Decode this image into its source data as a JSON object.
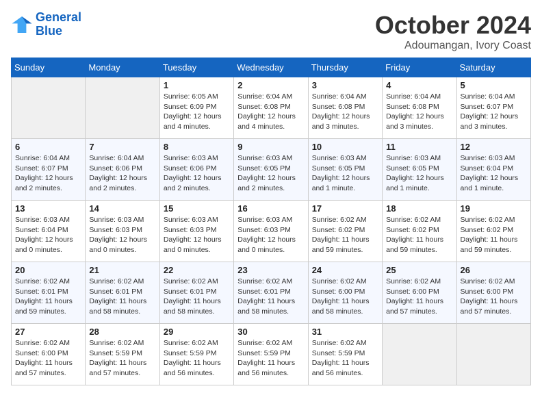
{
  "logo": {
    "line1": "General",
    "line2": "Blue"
  },
  "title": "October 2024",
  "subtitle": "Adoumangan, Ivory Coast",
  "weekdays": [
    "Sunday",
    "Monday",
    "Tuesday",
    "Wednesday",
    "Thursday",
    "Friday",
    "Saturday"
  ],
  "weeks": [
    [
      {
        "day": "",
        "info": ""
      },
      {
        "day": "",
        "info": ""
      },
      {
        "day": "1",
        "info": "Sunrise: 6:05 AM\nSunset: 6:09 PM\nDaylight: 12 hours\nand 4 minutes."
      },
      {
        "day": "2",
        "info": "Sunrise: 6:04 AM\nSunset: 6:08 PM\nDaylight: 12 hours\nand 4 minutes."
      },
      {
        "day": "3",
        "info": "Sunrise: 6:04 AM\nSunset: 6:08 PM\nDaylight: 12 hours\nand 3 minutes."
      },
      {
        "day": "4",
        "info": "Sunrise: 6:04 AM\nSunset: 6:08 PM\nDaylight: 12 hours\nand 3 minutes."
      },
      {
        "day": "5",
        "info": "Sunrise: 6:04 AM\nSunset: 6:07 PM\nDaylight: 12 hours\nand 3 minutes."
      }
    ],
    [
      {
        "day": "6",
        "info": "Sunrise: 6:04 AM\nSunset: 6:07 PM\nDaylight: 12 hours\nand 2 minutes."
      },
      {
        "day": "7",
        "info": "Sunrise: 6:04 AM\nSunset: 6:06 PM\nDaylight: 12 hours\nand 2 minutes."
      },
      {
        "day": "8",
        "info": "Sunrise: 6:03 AM\nSunset: 6:06 PM\nDaylight: 12 hours\nand 2 minutes."
      },
      {
        "day": "9",
        "info": "Sunrise: 6:03 AM\nSunset: 6:05 PM\nDaylight: 12 hours\nand 2 minutes."
      },
      {
        "day": "10",
        "info": "Sunrise: 6:03 AM\nSunset: 6:05 PM\nDaylight: 12 hours\nand 1 minute."
      },
      {
        "day": "11",
        "info": "Sunrise: 6:03 AM\nSunset: 6:05 PM\nDaylight: 12 hours\nand 1 minute."
      },
      {
        "day": "12",
        "info": "Sunrise: 6:03 AM\nSunset: 6:04 PM\nDaylight: 12 hours\nand 1 minute."
      }
    ],
    [
      {
        "day": "13",
        "info": "Sunrise: 6:03 AM\nSunset: 6:04 PM\nDaylight: 12 hours\nand 0 minutes."
      },
      {
        "day": "14",
        "info": "Sunrise: 6:03 AM\nSunset: 6:03 PM\nDaylight: 12 hours\nand 0 minutes."
      },
      {
        "day": "15",
        "info": "Sunrise: 6:03 AM\nSunset: 6:03 PM\nDaylight: 12 hours\nand 0 minutes."
      },
      {
        "day": "16",
        "info": "Sunrise: 6:03 AM\nSunset: 6:03 PM\nDaylight: 12 hours\nand 0 minutes."
      },
      {
        "day": "17",
        "info": "Sunrise: 6:02 AM\nSunset: 6:02 PM\nDaylight: 11 hours\nand 59 minutes."
      },
      {
        "day": "18",
        "info": "Sunrise: 6:02 AM\nSunset: 6:02 PM\nDaylight: 11 hours\nand 59 minutes."
      },
      {
        "day": "19",
        "info": "Sunrise: 6:02 AM\nSunset: 6:02 PM\nDaylight: 11 hours\nand 59 minutes."
      }
    ],
    [
      {
        "day": "20",
        "info": "Sunrise: 6:02 AM\nSunset: 6:01 PM\nDaylight: 11 hours\nand 59 minutes."
      },
      {
        "day": "21",
        "info": "Sunrise: 6:02 AM\nSunset: 6:01 PM\nDaylight: 11 hours\nand 58 minutes."
      },
      {
        "day": "22",
        "info": "Sunrise: 6:02 AM\nSunset: 6:01 PM\nDaylight: 11 hours\nand 58 minutes."
      },
      {
        "day": "23",
        "info": "Sunrise: 6:02 AM\nSunset: 6:01 PM\nDaylight: 11 hours\nand 58 minutes."
      },
      {
        "day": "24",
        "info": "Sunrise: 6:02 AM\nSunset: 6:00 PM\nDaylight: 11 hours\nand 58 minutes."
      },
      {
        "day": "25",
        "info": "Sunrise: 6:02 AM\nSunset: 6:00 PM\nDaylight: 11 hours\nand 57 minutes."
      },
      {
        "day": "26",
        "info": "Sunrise: 6:02 AM\nSunset: 6:00 PM\nDaylight: 11 hours\nand 57 minutes."
      }
    ],
    [
      {
        "day": "27",
        "info": "Sunrise: 6:02 AM\nSunset: 6:00 PM\nDaylight: 11 hours\nand 57 minutes."
      },
      {
        "day": "28",
        "info": "Sunrise: 6:02 AM\nSunset: 5:59 PM\nDaylight: 11 hours\nand 57 minutes."
      },
      {
        "day": "29",
        "info": "Sunrise: 6:02 AM\nSunset: 5:59 PM\nDaylight: 11 hours\nand 56 minutes."
      },
      {
        "day": "30",
        "info": "Sunrise: 6:02 AM\nSunset: 5:59 PM\nDaylight: 11 hours\nand 56 minutes."
      },
      {
        "day": "31",
        "info": "Sunrise: 6:02 AM\nSunset: 5:59 PM\nDaylight: 11 hours\nand 56 minutes."
      },
      {
        "day": "",
        "info": ""
      },
      {
        "day": "",
        "info": ""
      }
    ]
  ]
}
